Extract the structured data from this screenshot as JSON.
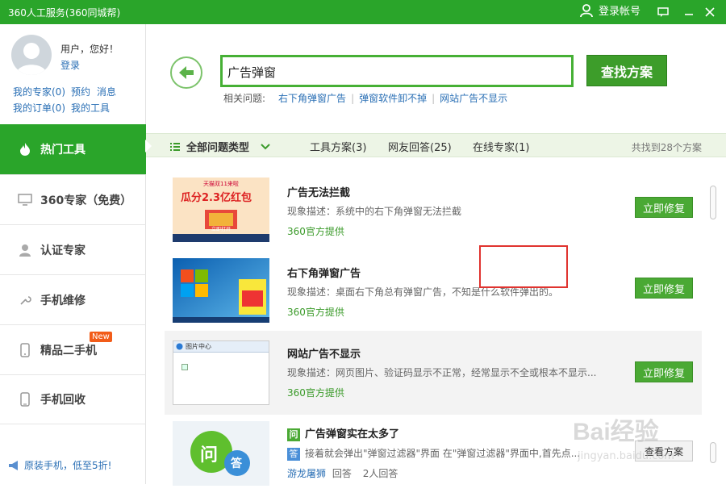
{
  "window": {
    "title": "360人工服务(360同城帮)",
    "login_label": "登录帐号"
  },
  "user": {
    "greeting": "用户，您好！",
    "login": "登录",
    "links": [
      "我的专家(0)",
      "预约",
      "消息",
      "我的订单(0)",
      "我的工具"
    ]
  },
  "nav": [
    {
      "label": "热门工具",
      "icon": "fire-icon",
      "active": true
    },
    {
      "label": "360专家（免费）",
      "icon": "monitor-icon"
    },
    {
      "label": "认证专家",
      "icon": "person-icon"
    },
    {
      "label": "手机维修",
      "icon": "wrench-icon"
    },
    {
      "label": "精品二手机",
      "icon": "phone-icon",
      "badge": "New"
    },
    {
      "label": "手机回收",
      "icon": "phone-recycle-icon"
    }
  ],
  "promo": "原装手机，低至5折!",
  "search": {
    "value": "广告弹窗",
    "button": "查找方案",
    "related_label": "相关问题:",
    "related": [
      "右下角弹窗广告",
      "弹窗软件卸不掉",
      "网站广告不显示"
    ]
  },
  "filters": {
    "all": "全部问题类型",
    "tools": "工具方案(3)",
    "answers": "网友回答(25)",
    "experts": "在线专家(1)",
    "count": "共找到28个方案"
  },
  "results": [
    {
      "title": "广告无法拦截",
      "desc": "现象描述：系统中的右下角弹窗无法拦截",
      "source": "360官方提供",
      "button": "立即修复",
      "thumb_text": [
        "天猫双11来啦",
        "瓜分2.3亿红包",
        "立即打开"
      ]
    },
    {
      "title": "右下角弹窗广告",
      "desc": "现象描述：桌面右下角总有弹窗广告，不知是什么软件弹出的。",
      "source": "360官方提供",
      "button": "立即修复"
    },
    {
      "title": "网站广告不显示",
      "desc": "现象描述：网页图片、验证码显示不正常，经常显示不全或根本不显示...",
      "source": "360官方提供",
      "button": "立即修复",
      "thumb_text": [
        "图片中心"
      ]
    },
    {
      "title": "广告弹窗实在太多了",
      "q_badge": "问",
      "a_badge": "答",
      "answer": "接着就会弹出\"弹窗过滤器\"界面    在\"弹窗过滤器\"界面中,首先点...",
      "author": "游龙屠狮",
      "author_suffix": "回答",
      "answers": "2人回答",
      "button": "查看方案",
      "thumb_text": [
        "问",
        "答"
      ]
    }
  ],
  "watermark": {
    "brand": "Bai经验",
    "url": "jingyan.baidu.com"
  }
}
